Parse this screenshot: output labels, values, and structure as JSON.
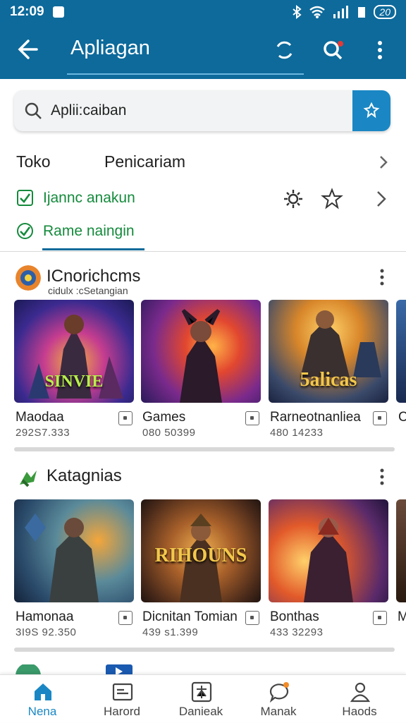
{
  "status_bar": {
    "time": "12:09",
    "battery": "20"
  },
  "app_bar": {
    "title": "Apliagan"
  },
  "search": {
    "value": "Aplii:caiban"
  },
  "store_row": {
    "left": "Toko",
    "right": "Penicariam"
  },
  "filters": [
    {
      "label": "Ijannc anakun",
      "checked": true
    },
    {
      "label": "Rame naingin",
      "checked": true
    }
  ],
  "sections": [
    {
      "title": "ICnorichcms",
      "subtitle": "cidulx :cSetangian",
      "cards": [
        {
          "name": "Maodaa",
          "meta": "292S7.333",
          "caption": "SINVIE"
        },
        {
          "name": "Games",
          "meta": "080 50399",
          "caption": ""
        },
        {
          "name": "Rarneotnanliea",
          "meta": "480 14233",
          "caption": "5alicas"
        }
      ]
    },
    {
      "title": "Katagnias",
      "cards": [
        {
          "name": "Hamonaa",
          "meta": "3I9S 92.350",
          "caption": ""
        },
        {
          "name": "Dicnitan Tomian",
          "meta": "439 s1.399",
          "caption": "RIHOUNS"
        },
        {
          "name": "Bonthas",
          "meta": "433 32293",
          "caption": ""
        }
      ]
    }
  ],
  "partial_peek": {
    "card_initials": [
      "C",
      "M"
    ]
  },
  "bottom_nav": [
    {
      "label": "Nena",
      "active": true,
      "icon": "home-icon"
    },
    {
      "label": "Harord",
      "active": false,
      "icon": "image-icon"
    },
    {
      "label": "Danieak",
      "active": false,
      "icon": "apps-icon"
    },
    {
      "label": "Manak",
      "active": false,
      "icon": "chat-icon"
    },
    {
      "label": "Haods",
      "active": false,
      "icon": "person-icon"
    }
  ],
  "colors": {
    "primary": "#0d6a9b",
    "accent": "#1a87c4",
    "filter_green": "#158a3c"
  }
}
